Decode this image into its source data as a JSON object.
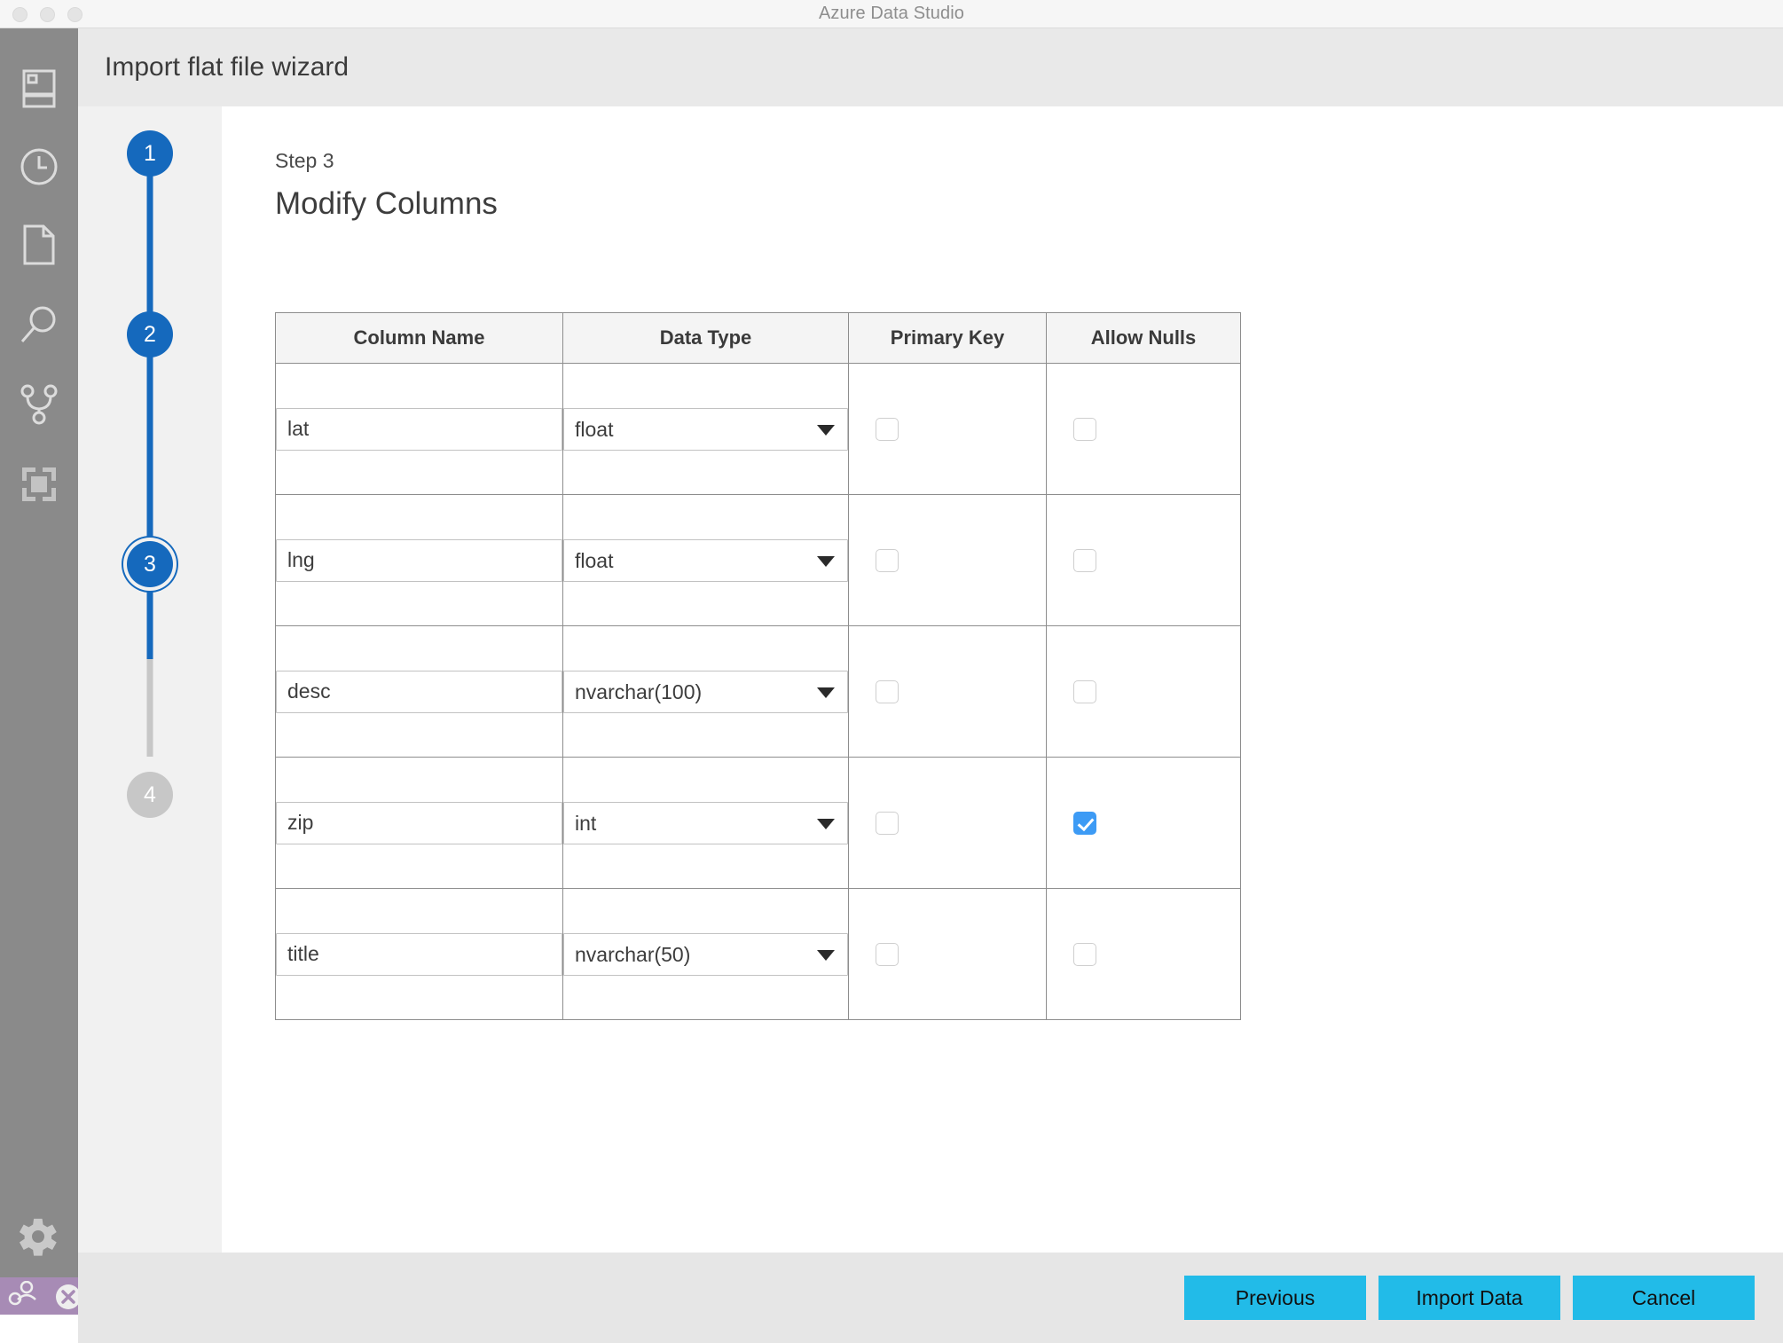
{
  "window": {
    "title": "Azure Data Studio",
    "traffic_lights": [
      "close",
      "minimize",
      "zoom"
    ]
  },
  "activitybar": {
    "items": [
      {
        "name": "servers-icon",
        "label": "Servers"
      },
      {
        "name": "history-icon",
        "label": "History"
      },
      {
        "name": "file-icon",
        "label": "Notebooks"
      },
      {
        "name": "search-icon",
        "label": "Search"
      },
      {
        "name": "source-control-icon",
        "label": "Source Control"
      },
      {
        "name": "extensions-icon",
        "label": "Extensions"
      }
    ],
    "gear": {
      "name": "gear-icon",
      "label": "Manage"
    },
    "statusbar": {
      "accent": "#a78bb5",
      "items": [
        {
          "name": "account-icon",
          "label": "Accounts"
        },
        {
          "name": "error-icon",
          "label": "Errors"
        }
      ]
    }
  },
  "wizard": {
    "title": "Import flat file wizard",
    "step_label": "Step 3",
    "heading": "Modify Columns",
    "steps": [
      {
        "number": "1",
        "state": "done"
      },
      {
        "number": "2",
        "state": "done"
      },
      {
        "number": "3",
        "state": "current"
      },
      {
        "number": "4",
        "state": "inactive"
      }
    ],
    "accent_blue": "#1569bd"
  },
  "table": {
    "headers": [
      "Column Name",
      "Data Type",
      "Primary Key",
      "Allow Nulls"
    ],
    "rows": [
      {
        "column_name": "lat",
        "data_type": "float",
        "primary_key": false,
        "allow_nulls": false
      },
      {
        "column_name": "lng",
        "data_type": "float",
        "primary_key": false,
        "allow_nulls": false
      },
      {
        "column_name": "desc",
        "data_type": "nvarchar(100)",
        "primary_key": false,
        "allow_nulls": false
      },
      {
        "column_name": "zip",
        "data_type": "int",
        "primary_key": false,
        "allow_nulls": true
      },
      {
        "column_name": "title",
        "data_type": "nvarchar(50)",
        "primary_key": false,
        "allow_nulls": false
      }
    ]
  },
  "footer": {
    "buttons": [
      {
        "name": "previous-button",
        "label": "Previous"
      },
      {
        "name": "import-data-button",
        "label": "Import Data"
      },
      {
        "name": "cancel-button",
        "label": "Cancel"
      }
    ],
    "button_color": "#22bbe8"
  }
}
